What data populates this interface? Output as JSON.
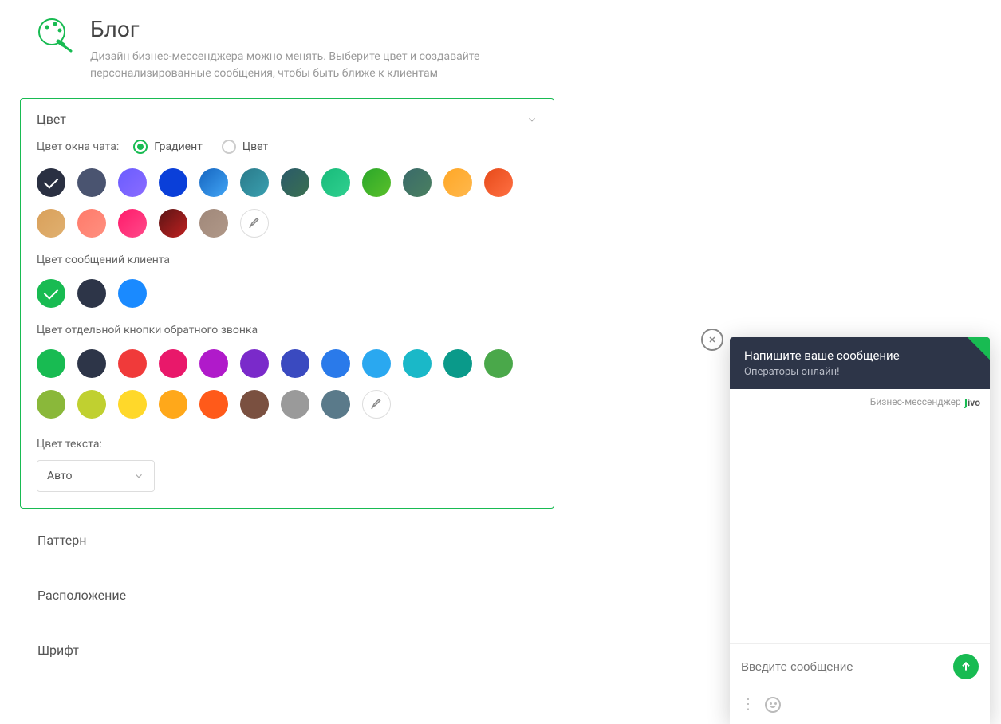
{
  "header": {
    "title": "Блог",
    "description": "Дизайн бизнес-мессенджера можно менять. Выберите цвет и создавайте персонализированные сообщения, чтобы быть ближе к клиентам"
  },
  "sections": {
    "color": {
      "title": "Цвет",
      "window_color_label": "Цвет окна чата:",
      "radio_gradient": "Градиент",
      "radio_color": "Цвет",
      "gradients": [
        {
          "bg": "linear-gradient(135deg,#2a3042,#2a3042)",
          "selected": true
        },
        {
          "bg": "linear-gradient(135deg,#4a5470,#4a5470)"
        },
        {
          "bg": "linear-gradient(135deg,#6a5cff,#8a6cff)"
        },
        {
          "bg": "linear-gradient(135deg,#0a3fd9,#0a3fd9)"
        },
        {
          "bg": "linear-gradient(135deg,#1565c0,#42a5f5)"
        },
        {
          "bg": "linear-gradient(135deg,#2a7a8a,#3aa0b0)"
        },
        {
          "bg": "linear-gradient(135deg,#2a5a6a,#3a7050)"
        },
        {
          "bg": "linear-gradient(135deg,#18bb7a,#30d090)"
        },
        {
          "bg": "linear-gradient(135deg,#2aa72a,#5ac02a)"
        },
        {
          "bg": "linear-gradient(135deg,#3a6a6a,#4a8060)"
        },
        {
          "bg": "linear-gradient(135deg,#ffa726,#ffb84d)"
        },
        {
          "bg": "linear-gradient(135deg,#e64a19,#ff7043)"
        },
        {
          "bg": "linear-gradient(135deg,#d9a05a,#e0b070)"
        },
        {
          "bg": "linear-gradient(135deg,#ff7a6a,#ff9080)"
        },
        {
          "bg": "linear-gradient(135deg,#ff1a6a,#ff4a8a)"
        },
        {
          "bg": "linear-gradient(135deg,#5a1515,#c02020)"
        },
        {
          "bg": "linear-gradient(135deg,#a0887a,#b09888)"
        },
        {
          "picker": true
        }
      ],
      "client_msg_label": "Цвет сообщений клиента",
      "client_colors": [
        {
          "bg": "#18bb52",
          "selected": true
        },
        {
          "bg": "#2d3548"
        },
        {
          "bg": "#1a8aff"
        }
      ],
      "callback_label": "Цвет отдельной кнопки обратного звонка",
      "callback_colors": [
        {
          "bg": "#18bb52"
        },
        {
          "bg": "#2d3548"
        },
        {
          "bg": "#f03a3a"
        },
        {
          "bg": "#e9186a"
        },
        {
          "bg": "#b01aca"
        },
        {
          "bg": "#7a2aca"
        },
        {
          "bg": "#3a4ac0"
        },
        {
          "bg": "#2a7aea"
        },
        {
          "bg": "#2aa8f0"
        },
        {
          "bg": "#1ab8c8"
        },
        {
          "bg": "#0a9a8a"
        },
        {
          "bg": "#4aa84a"
        },
        {
          "bg": "#8ab83a"
        },
        {
          "bg": "#c0d030"
        },
        {
          "bg": "#ffd82a"
        },
        {
          "bg": "#ffa81a"
        },
        {
          "bg": "#ff5a1a"
        },
        {
          "bg": "#7a5040"
        },
        {
          "bg": "#9a9a9a"
        },
        {
          "bg": "#5a7a8a"
        },
        {
          "picker": true
        }
      ],
      "text_color_label": "Цвет текста:",
      "text_color_value": "Авто"
    },
    "pattern": {
      "title": "Паттерн"
    },
    "position": {
      "title": "Расположение"
    },
    "font": {
      "title": "Шрифт"
    }
  },
  "chat": {
    "title": "Напишите ваше сообщение",
    "subtitle": "Операторы онлайн!",
    "brand_prefix": "Бизнес-мессенджер",
    "brand_name": "jivo",
    "input_placeholder": "Введите сообщение"
  }
}
